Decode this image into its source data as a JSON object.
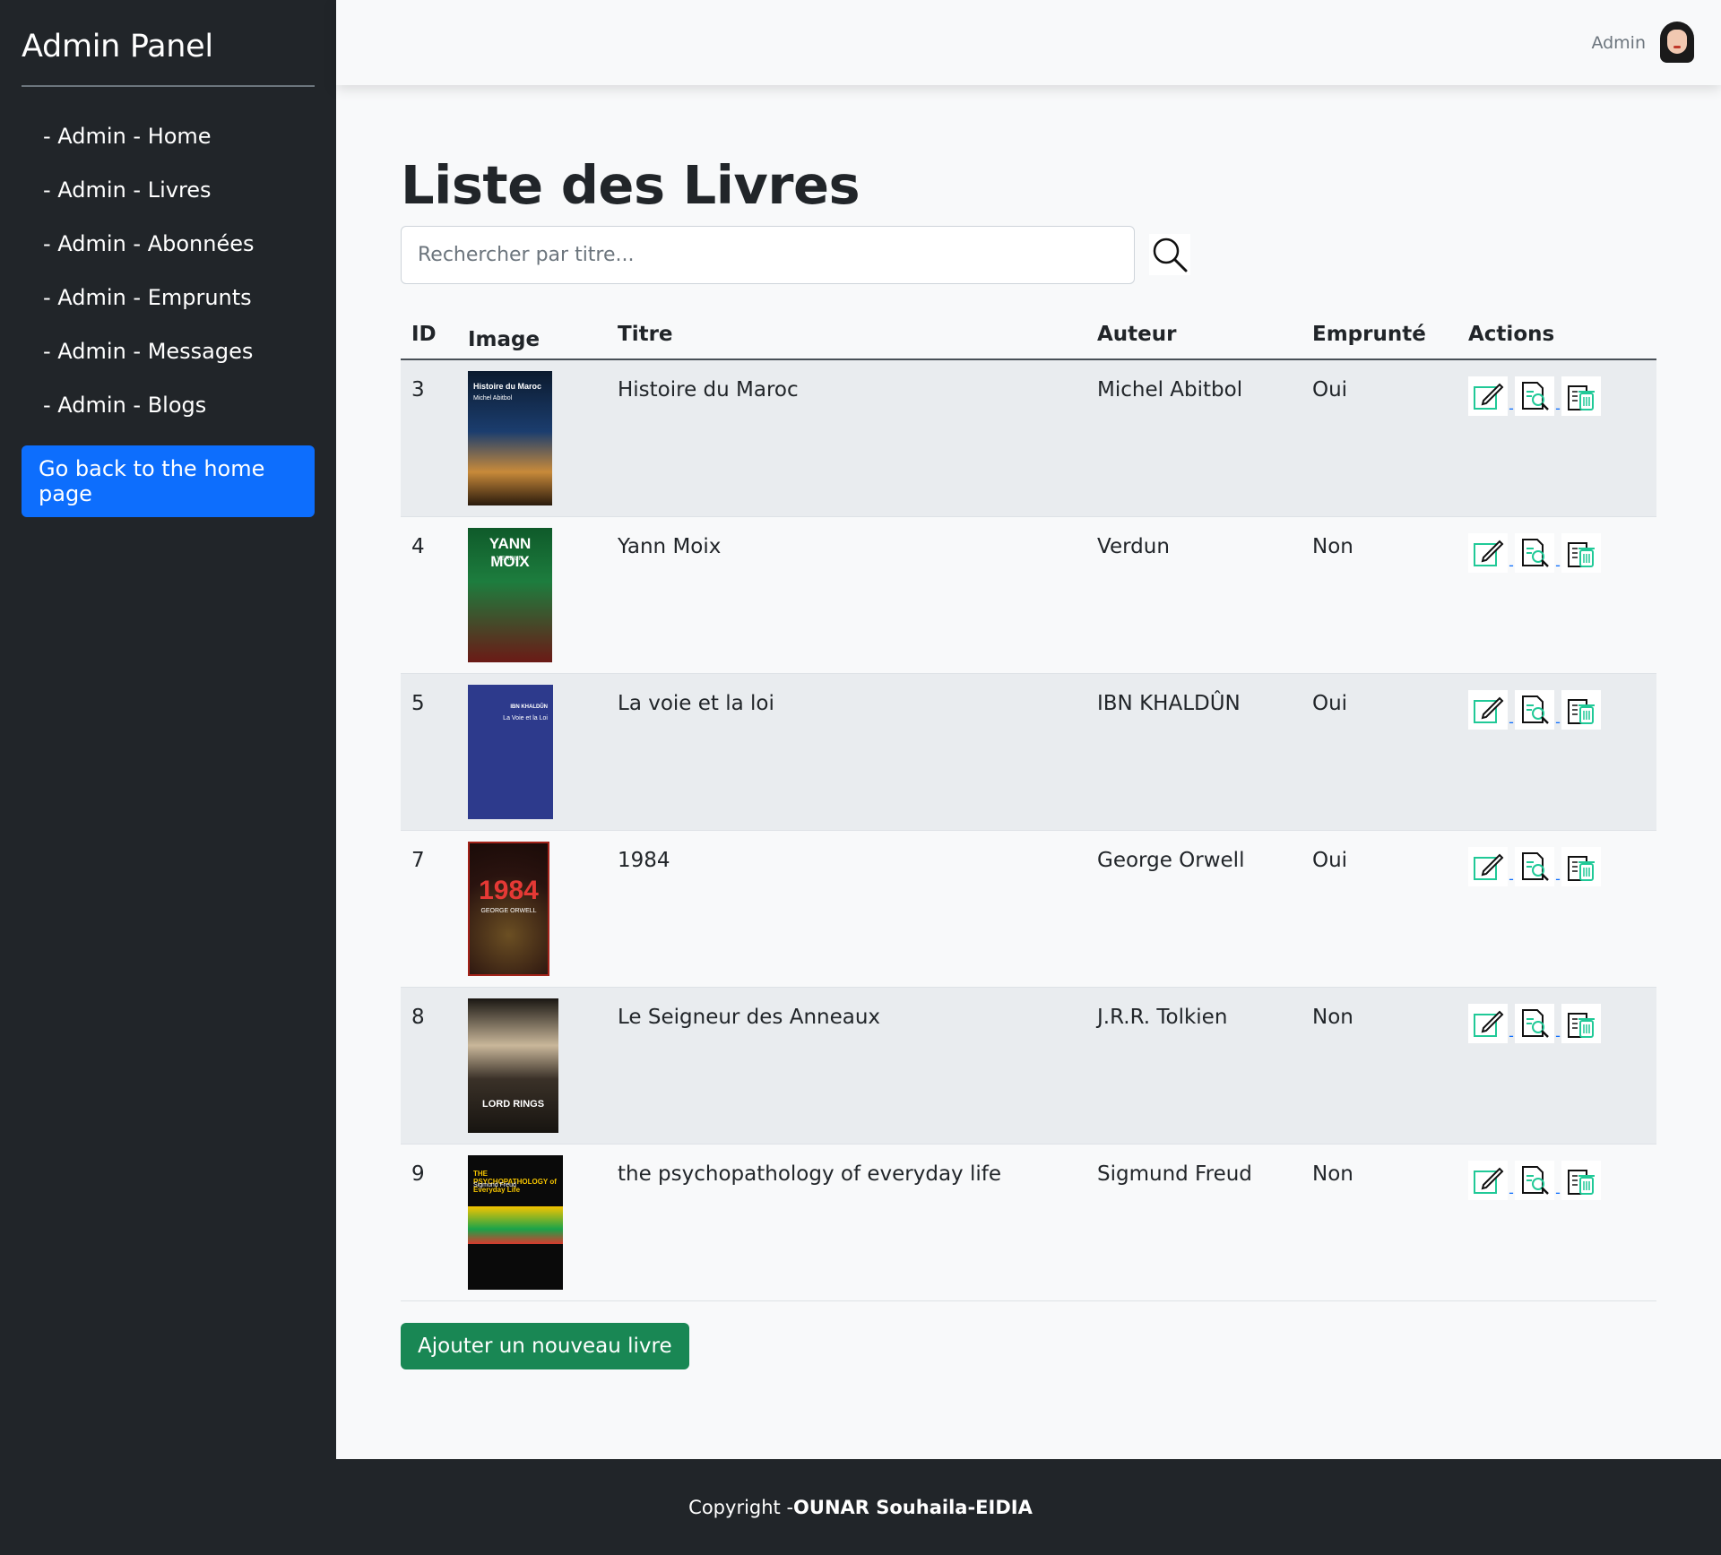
{
  "sidebar": {
    "brand": "Admin Panel",
    "items": [
      {
        "label": "- Admin - Home"
      },
      {
        "label": "- Admin - Livres"
      },
      {
        "label": "- Admin - Abonnées"
      },
      {
        "label": "- Admin - Emprunts"
      },
      {
        "label": "- Admin - Messages"
      },
      {
        "label": "- Admin - Blogs"
      }
    ],
    "home_button": "Go back to the home page"
  },
  "header": {
    "user_name": "Admin",
    "avatar_icon": "user-avatar"
  },
  "main": {
    "title": "Liste des Livres",
    "search": {
      "placeholder": "Rechercher par titre...",
      "value": "",
      "icon": "search-icon"
    },
    "table": {
      "headers": [
        "ID",
        "Image",
        "Titre",
        "Auteur",
        "Emprunté",
        "Actions"
      ],
      "rows": [
        {
          "id": "3",
          "titre": "Histoire du Maroc",
          "auteur": "Michel Abitbol",
          "emprunte": "Oui",
          "cover_text": "Histoire du Maroc",
          "cover_sub": "Michel Abitbol"
        },
        {
          "id": "4",
          "titre": "Yann Moix",
          "auteur": "Verdun",
          "emprunte": "Non",
          "cover_text": "YANN MOIX",
          "cover_sub": "VERDUN"
        },
        {
          "id": "5",
          "titre": "La voie et la loi",
          "auteur": "IBN KHALDÛN",
          "emprunte": "Oui",
          "cover_text": "IBN KHALDÛN",
          "cover_sub": "La Voie et la Loi"
        },
        {
          "id": "7",
          "titre": "1984",
          "auteur": "George Orwell",
          "emprunte": "Oui",
          "cover_text": "1984",
          "cover_sub": "GEORGE ORWELL"
        },
        {
          "id": "8",
          "titre": "Le Seigneur des Anneaux",
          "auteur": "J.R.R. Tolkien",
          "emprunte": "Non",
          "cover_text": "LORD RINGS",
          "cover_sub": ""
        },
        {
          "id": "9",
          "titre": "the psychopathology of everyday life",
          "auteur": "Sigmund Freud",
          "emprunte": "Non",
          "cover_text": "THE PSYCHOPATHOLOGY of Everyday Life",
          "cover_sub": "Sigmund Freud"
        }
      ]
    },
    "add_button": "Ajouter un nouveau livre"
  },
  "footer": {
    "prefix": "Copyright - ",
    "author": "OUNAR Souhaila",
    "dash": " - ",
    "org": "EIDIA"
  },
  "colors": {
    "sidebar_bg": "#212529",
    "primary": "#0d6efd",
    "success": "#198754",
    "action_icon": "#20c997"
  }
}
